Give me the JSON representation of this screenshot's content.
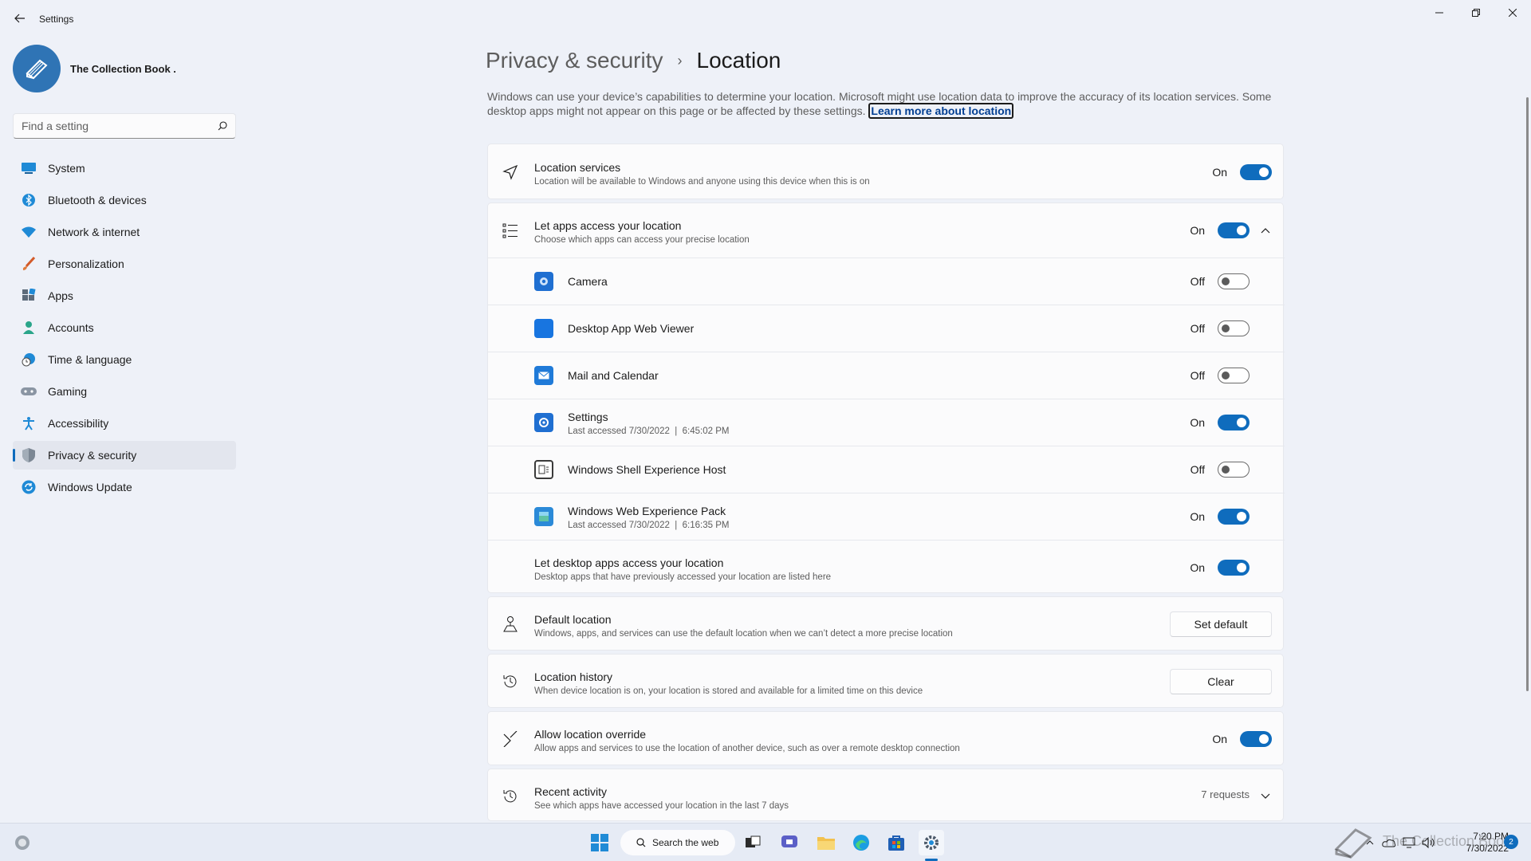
{
  "window": {
    "title": "Settings",
    "controls": {
      "minimize": "minimize-icon",
      "maximize": "restore-icon",
      "close": "close-icon"
    }
  },
  "profile": {
    "name": "The Collection Book ."
  },
  "search": {
    "placeholder": "Find a setting"
  },
  "sidebar": {
    "items": [
      {
        "label": "System",
        "icon": "system-icon"
      },
      {
        "label": "Bluetooth & devices",
        "icon": "bluetooth-icon"
      },
      {
        "label": "Network & internet",
        "icon": "wifi-icon"
      },
      {
        "label": "Personalization",
        "icon": "brush-icon"
      },
      {
        "label": "Apps",
        "icon": "apps-icon"
      },
      {
        "label": "Accounts",
        "icon": "account-icon"
      },
      {
        "label": "Time & language",
        "icon": "clock-globe-icon"
      },
      {
        "label": "Gaming",
        "icon": "gamepad-icon"
      },
      {
        "label": "Accessibility",
        "icon": "accessibility-icon"
      },
      {
        "label": "Privacy & security",
        "icon": "shield-icon",
        "active": true
      },
      {
        "label": "Windows Update",
        "icon": "update-icon"
      }
    ]
  },
  "breadcrumb": {
    "parent": "Privacy & security",
    "separator": "›",
    "current": "Location"
  },
  "intro": {
    "text": "Windows can use your device’s capabilities to determine your location. Microsoft might use location data to improve the accuracy of its location services. Some desktop apps might not appear on this page or be affected by these settings.",
    "link": "Learn more about location"
  },
  "location_services": {
    "title": "Location services",
    "desc": "Location will be available to Windows and anyone using this device when this is on",
    "state": "On"
  },
  "apps_access": {
    "title": "Let apps access your location",
    "desc": "Choose which apps can access your precise location",
    "state": "On",
    "apps": [
      {
        "name": "Camera",
        "detail": "",
        "state": "Off",
        "icon": "camera-app-icon"
      },
      {
        "name": "Desktop App Web Viewer",
        "detail": "",
        "state": "Off",
        "icon": "web-viewer-app-icon"
      },
      {
        "name": "Mail and Calendar",
        "detail": "",
        "state": "Off",
        "icon": "mail-app-icon"
      },
      {
        "name": "Settings",
        "detail": "Last accessed 7/30/2022  |  6:45:02 PM",
        "state": "On",
        "icon": "settings-app-icon"
      },
      {
        "name": "Windows Shell Experience Host",
        "detail": "",
        "state": "Off",
        "icon": "shell-host-app-icon"
      },
      {
        "name": "Windows Web Experience Pack",
        "detail": "Last accessed 7/30/2022  |  6:16:35 PM",
        "state": "On",
        "icon": "web-experience-app-icon"
      }
    ],
    "desktop": {
      "title": "Let desktop apps access your location",
      "desc": "Desktop apps that have previously accessed your location are listed here",
      "state": "On"
    }
  },
  "default_location": {
    "title": "Default location",
    "desc": "Windows, apps, and services can use the default location when we can’t detect a more precise location",
    "button": "Set default"
  },
  "location_history": {
    "title": "Location history",
    "desc": "When device location is on, your location is stored and available for a limited time on this device",
    "button": "Clear"
  },
  "override": {
    "title": "Allow location override",
    "desc": "Allow apps and services to use the location of another device, such as over a remote desktop connection",
    "state": "On"
  },
  "recent": {
    "title": "Recent activity",
    "desc": "See which apps have accessed your location in the last 7 days",
    "count": "7 requests"
  },
  "taskbar": {
    "search_label": "Search the web",
    "time": "7:20 PM",
    "date": "7/30/2022",
    "notifications": "2",
    "watermark": "The Collection Book"
  }
}
